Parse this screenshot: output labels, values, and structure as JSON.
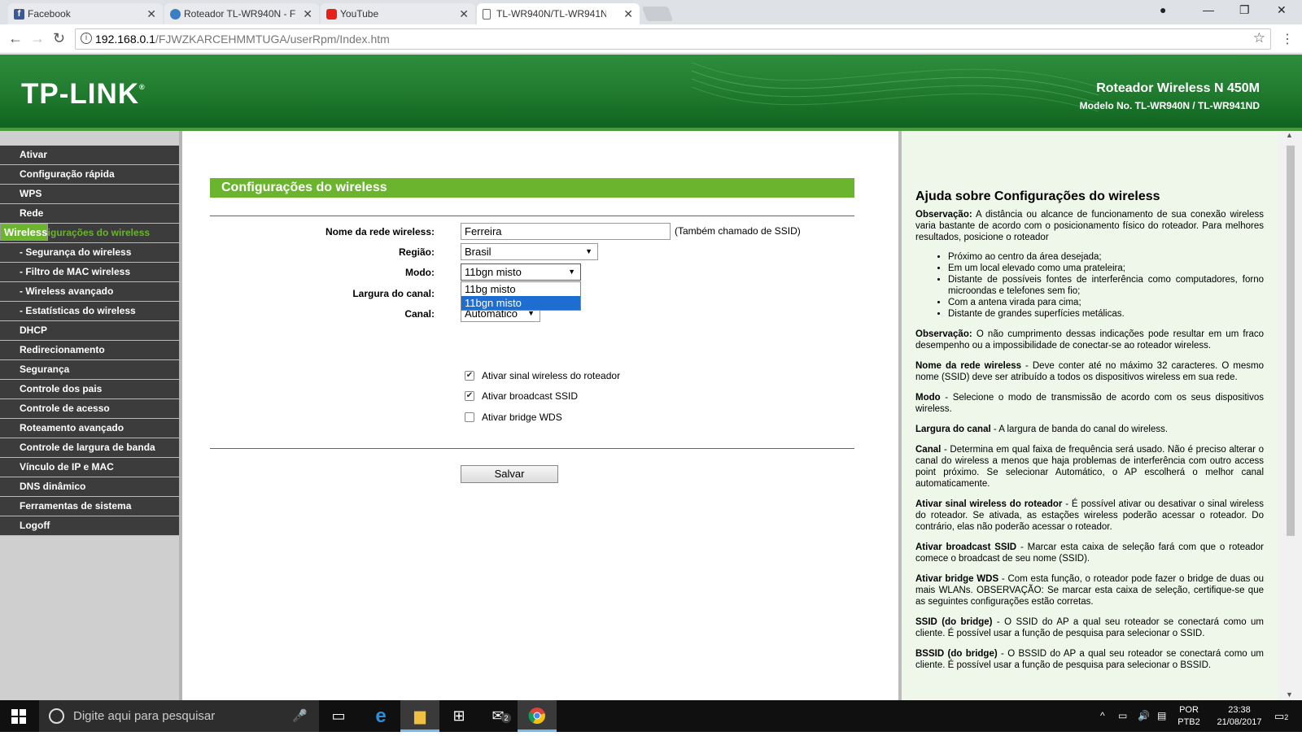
{
  "browser": {
    "tabs": [
      {
        "label": "Facebook",
        "icon": "facebook-icon",
        "color": "#3b5998",
        "active": false
      },
      {
        "label": "Roteador TL-WR940N - F",
        "icon": "router-icon",
        "color": "#3a7fc4",
        "active": false
      },
      {
        "label": "YouTube",
        "icon": "youtube-icon",
        "color": "#e62117",
        "active": false
      },
      {
        "label": "TL-WR940N/TL-WR941N",
        "icon": "page-icon",
        "color": "#666666",
        "active": true
      }
    ],
    "url_host": "192.168.0.1",
    "url_path": "/FJWZKARCEHMMTUGA/userRpm/Index.htm"
  },
  "header": {
    "logo": "TP-LINK",
    "product": "Roteador Wireless N 450M",
    "model": "Modelo No. TL-WR940N / TL-WR941ND"
  },
  "sidebar": {
    "items": [
      {
        "label": "Ativar",
        "type": "top"
      },
      {
        "label": "Configuração rápida",
        "type": "top"
      },
      {
        "label": "WPS",
        "type": "top"
      },
      {
        "label": "Rede",
        "type": "top"
      },
      {
        "label": "Wireless",
        "type": "selected"
      },
      {
        "label": "- Configurações do wireless",
        "type": "subselected"
      },
      {
        "label": "- Segurança do wireless",
        "type": "sub"
      },
      {
        "label": "- Filtro de MAC wireless",
        "type": "sub"
      },
      {
        "label": "- Wireless avançado",
        "type": "sub"
      },
      {
        "label": "- Estatísticas do wireless",
        "type": "sub"
      },
      {
        "label": "DHCP",
        "type": "top"
      },
      {
        "label": "Redirecionamento",
        "type": "top"
      },
      {
        "label": "Segurança",
        "type": "top"
      },
      {
        "label": "Controle dos pais",
        "type": "top"
      },
      {
        "label": "Controle de acesso",
        "type": "top"
      },
      {
        "label": "Roteamento avançado",
        "type": "top"
      },
      {
        "label": "Controle de largura de banda",
        "type": "top"
      },
      {
        "label": "Vínculo de IP e MAC",
        "type": "top"
      },
      {
        "label": "DNS dinâmico",
        "type": "top"
      },
      {
        "label": "Ferramentas de sistema",
        "type": "top"
      },
      {
        "label": "Logoff",
        "type": "top"
      }
    ]
  },
  "form": {
    "title": "Configurações do wireless",
    "ssid_label": "Nome da rede wireless:",
    "ssid_value": "Ferreira",
    "ssid_note": "(Também chamado de SSID)",
    "region_label": "Região:",
    "region_value": "Brasil",
    "mode_label": "Modo:",
    "mode_value": "11bgn misto",
    "mode_options": [
      "11bg misto",
      "11bgn misto"
    ],
    "width_label": "Largura do canal:",
    "channel_label": "Canal:",
    "channel_value": "Automático",
    "chk_radio": "Ativar sinal wireless do roteador",
    "chk_radio_checked": true,
    "chk_ssid": "Ativar broadcast SSID",
    "chk_ssid_checked": true,
    "chk_wds": "Ativar bridge WDS",
    "chk_wds_checked": false,
    "save": "Salvar"
  },
  "help": {
    "title": "Ajuda sobre Configurações do wireless",
    "obs1_b": "Observação:",
    "obs1": " A distância ou alcance de funcionamento de sua conexão wireless varia bastante de acordo com o posicionamento físico do roteador. Para melhores resultados, posicione o roteador",
    "bullets": [
      "Próximo ao centro da área desejada;",
      "Em um local elevado como uma prateleira;",
      "Distante de possíveis fontes de interferência como computadores, forno microondas e telefones sem fio;",
      "Com a antena virada para cima;",
      "Distante de grandes superfícies metálicas."
    ],
    "obs2_b": "Observação:",
    "obs2": " O não cumprimento dessas indicações pode resultar em um fraco desempenho ou a impossibilidade de conectar-se ao roteador wireless.",
    "p_ssid_b": "Nome da rede wireless",
    "p_ssid": " - Deve conter até no máximo 32 caracteres. O mesmo nome (SSID) deve ser atribuído a todos os dispositivos wireless em sua rede.",
    "p_mode_b": "Modo",
    "p_mode": " - Selecione o modo de transmissão de acordo com os seus dispositivos wireless.",
    "p_width_b": "Largura do canal",
    "p_width": " - A largura de banda do canal do wireless.",
    "p_chan_b": "Canal",
    "p_chan": " - Determina em qual faixa de frequência será usado. Não é preciso alterar o canal do wireless a menos que haja problemas de interferência com outro access point próximo. Se selecionar Automático, o AP escolherá o melhor canal automaticamente.",
    "p_radio_b": "Ativar sinal wireless do roteador",
    "p_radio": " - É possível ativar ou desativar o sinal wireless do roteador. Se ativada, as estações wireless poderão acessar o roteador. Do contrário, elas não poderão acessar o roteador.",
    "p_bssid_b": "Ativar broadcast SSID",
    "p_bssid": " - Marcar esta caixa de seleção fará com que o roteador comece o broadcast de seu nome (SSID).",
    "p_wds_b": "Ativar bridge WDS",
    "p_wds": " - Com esta função, o roteador pode fazer o bridge de duas ou mais WLANs. OBSERVAÇÃO: Se marcar esta caixa de seleção, certifique-se que as seguintes configurações estão corretas.",
    "p_ssidb_b": "SSID (do bridge)",
    "p_ssidb": " - O SSID do AP a qual seu roteador se conectará como um cliente. É possível usar a função de pesquisa para selecionar o SSID.",
    "p_bssidb_b": "BSSID (do bridge)",
    "p_bssidb": " - O BSSID do AP a qual seu roteador se conectará como um cliente. É possível usar a função de pesquisa para selecionar o BSSID."
  },
  "taskbar": {
    "search_placeholder": "Digite aqui para pesquisar",
    "lang": "POR",
    "layout": "PTB2",
    "time": "23:38",
    "date": "21/08/2017",
    "mail_badge": "2",
    "notif_badge": "2"
  }
}
